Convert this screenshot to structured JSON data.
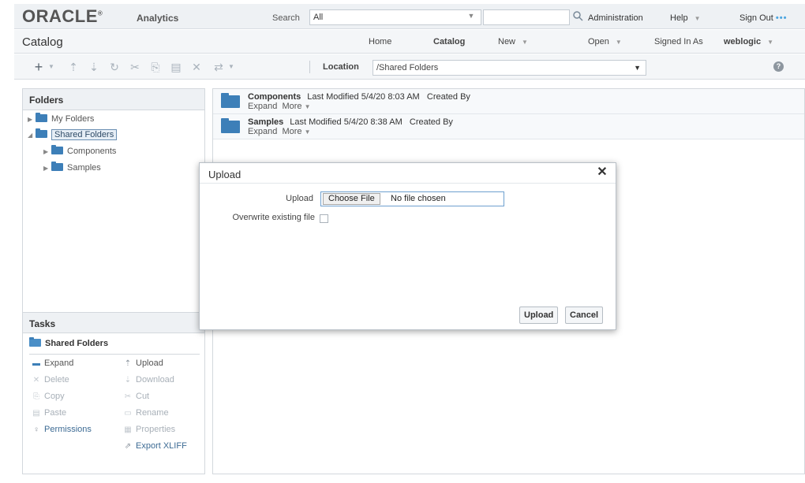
{
  "header": {
    "logo": "ORACLE",
    "product": "Analytics",
    "search_label": "Search",
    "search_scope": "All",
    "admin": "Administration",
    "help": "Help",
    "signout": "Sign Out"
  },
  "subheader": {
    "title": "Catalog",
    "home": "Home",
    "catalog": "Catalog",
    "new": "New",
    "open": "Open",
    "signed_in_as": "Signed In As",
    "user": "weblogic"
  },
  "toolbar": {
    "location_label": "Location",
    "location_value": "/Shared Folders"
  },
  "folders_panel": {
    "title": "Folders",
    "items": [
      {
        "label": "My Folders"
      },
      {
        "label": "Shared Folders"
      },
      {
        "label": "Components"
      },
      {
        "label": "Samples"
      }
    ]
  },
  "tasks_panel": {
    "title": "Tasks",
    "folder": "Shared Folders",
    "actions": [
      {
        "label": "Expand",
        "enabled": true
      },
      {
        "label": "Upload",
        "enabled": true
      },
      {
        "label": "Delete",
        "enabled": false
      },
      {
        "label": "Download",
        "enabled": false
      },
      {
        "label": "Copy",
        "enabled": false
      },
      {
        "label": "Cut",
        "enabled": false
      },
      {
        "label": "Paste",
        "enabled": false
      },
      {
        "label": "Rename",
        "enabled": false
      },
      {
        "label": "Permissions",
        "enabled": true
      },
      {
        "label": "Properties",
        "enabled": false
      },
      {
        "label": "Export XLIFF",
        "enabled": true
      }
    ]
  },
  "catalog_items": [
    {
      "name": "Components",
      "modified": "Last Modified 5/4/20 8:03 AM",
      "created": "Created By",
      "expand": "Expand",
      "more": "More"
    },
    {
      "name": "Samples",
      "modified": "Last Modified 5/4/20 8:38 AM",
      "created": "Created By",
      "expand": "Expand",
      "more": "More"
    }
  ],
  "dialog": {
    "title": "Upload",
    "upload_label": "Upload",
    "choose_file": "Choose File",
    "file_status": "No file chosen",
    "overwrite_label": "Overwrite existing file",
    "upload_button": "Upload",
    "cancel_button": "Cancel"
  }
}
